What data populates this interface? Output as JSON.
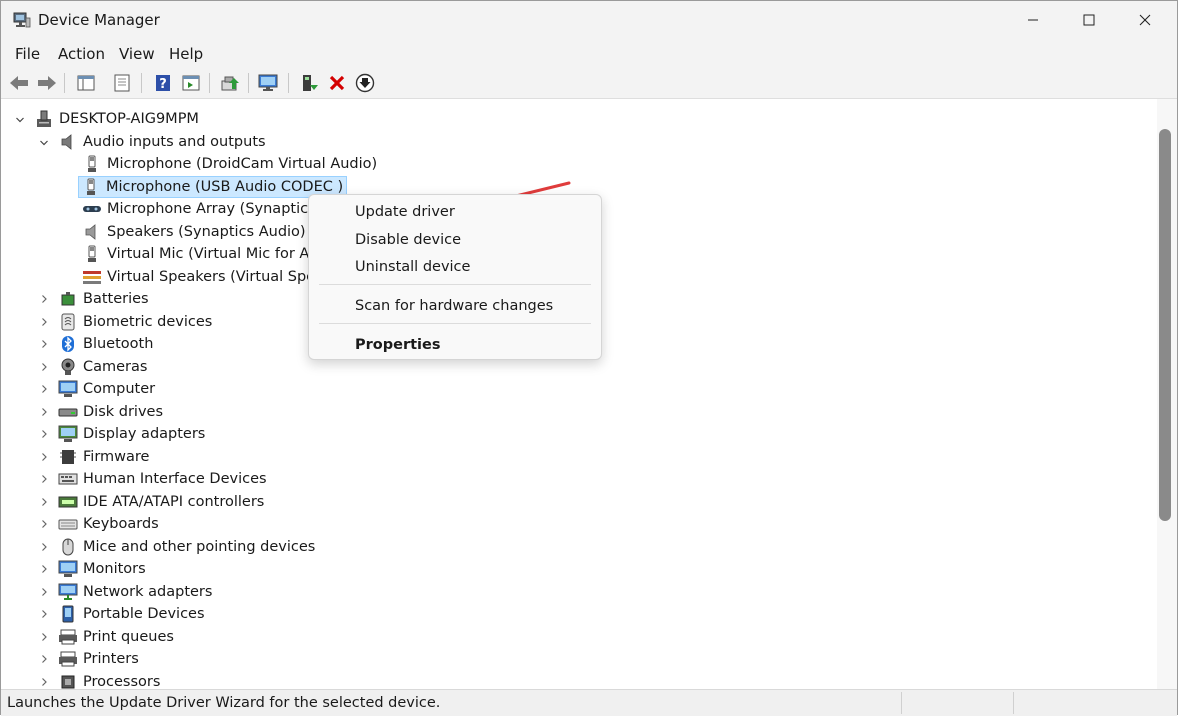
{
  "window": {
    "title": "Device Manager"
  },
  "menu": [
    "File",
    "Action",
    "View",
    "Help"
  ],
  "tree": {
    "computer": "DESKTOP-AIG9MPM",
    "audio_category": "Audio inputs and outputs",
    "audio_children": [
      "Microphone (DroidCam Virtual Audio)",
      "Microphone (USB Audio CODEC )",
      "Microphone Array (Synaptics A",
      "Speakers (Synaptics Audio)",
      "Virtual Mic (Virtual Mic for Aud",
      "Virtual Speakers (Virtual Speake"
    ],
    "categories": [
      "Batteries",
      "Biometric devices",
      "Bluetooth",
      "Cameras",
      "Computer",
      "Disk drives",
      "Display adapters",
      "Firmware",
      "Human Interface Devices",
      "IDE ATA/ATAPI controllers",
      "Keyboards",
      "Mice and other pointing devices",
      "Monitors",
      "Network adapters",
      "Portable Devices",
      "Print queues",
      "Printers",
      "Processors"
    ]
  },
  "context_menu": {
    "update": "Update driver",
    "disable": "Disable device",
    "uninstall": "Uninstall device",
    "scan": "Scan for hardware changes",
    "properties": "Properties"
  },
  "status": "Launches the Update Driver Wizard for the selected device.",
  "colors": {
    "selection": "#cce8ff",
    "annotation_arrow": "#e03c3c",
    "toolbar_bg": "#f3f3f3"
  }
}
